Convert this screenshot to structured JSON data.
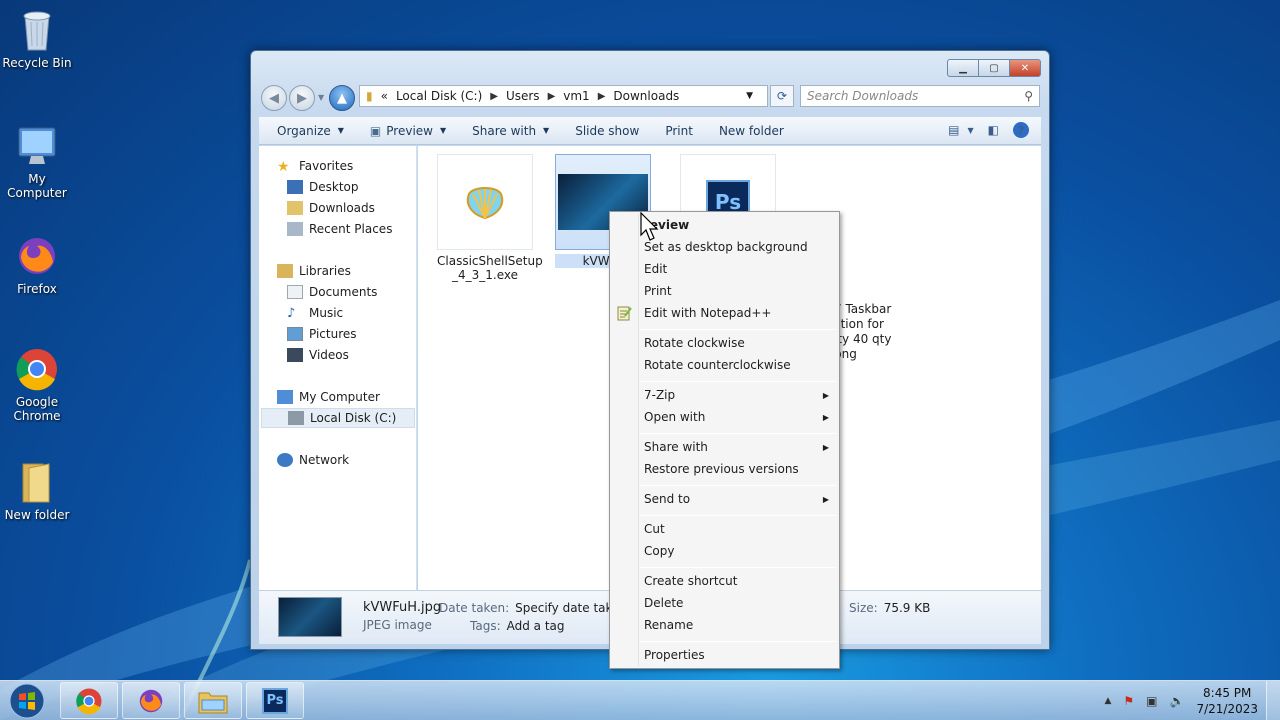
{
  "desktop": {
    "icons": [
      {
        "label": "Recycle Bin",
        "icon": "recycle-bin-icon"
      },
      {
        "label": "My Computer",
        "icon": "computer-icon"
      },
      {
        "label": "Firefox",
        "icon": "firefox-icon"
      },
      {
        "label": "Google Chrome",
        "icon": "chrome-icon"
      },
      {
        "label": "New folder",
        "icon": "folder-icon"
      }
    ]
  },
  "window": {
    "address": {
      "chevron": "«",
      "segments": [
        "Local Disk (C:)",
        "Users",
        "vm1",
        "Downloads"
      ]
    },
    "search_placeholder": "Search Downloads",
    "toolbar": {
      "organize": "Organize",
      "preview": "Preview",
      "share_with": "Share with",
      "slide_show": "Slide show",
      "print": "Print",
      "new_folder": "New folder"
    },
    "nav": {
      "favorites": "Favorites",
      "desktop": "Desktop",
      "downloads": "Downloads",
      "recent_places": "Recent Places",
      "libraries": "Libraries",
      "documents": "Documents",
      "music": "Music",
      "pictures": "Pictures",
      "videos": "Videos",
      "my_computer": "My Computer",
      "local_disk": "Local Disk (C:)",
      "network": "Network"
    },
    "files": [
      {
        "name_line1": "ClassicShellSetup",
        "name_line2": "_4_3_1.exe"
      },
      {
        "name_line1": "kVWFu",
        "name_line2": ""
      },
      {
        "name_line1": "7 Taskbar",
        "name_line2": "ction for",
        "name_line3": "ity 40 qty",
        "name_line4": "png"
      }
    ],
    "details": {
      "filename": "kVWFuH.jpg",
      "filetype": "JPEG image",
      "date_label": "Date taken:",
      "date_value": "Specify date taken",
      "tags_label": "Tags:",
      "tags_value": "Add a tag",
      "size_label": "Size:",
      "size_value": "75.9 KB"
    }
  },
  "context_menu": {
    "items": [
      "review",
      "Set as desktop background",
      "Edit",
      "Print",
      "Edit with Notepad++",
      "Rotate clockwise",
      "Rotate counterclockwise",
      "7-Zip",
      "Open with",
      "Share with",
      "Restore previous versions",
      "Send to",
      "Cut",
      "Copy",
      "Create shortcut",
      "Delete",
      "Rename",
      "Properties"
    ]
  },
  "taskbar": {
    "apps": [
      "chrome-icon",
      "firefox-icon",
      "explorer-icon",
      "photoshop-icon"
    ],
    "photoshop_label": "Ps",
    "time": "8:45 PM",
    "date": "7/21/2023"
  }
}
